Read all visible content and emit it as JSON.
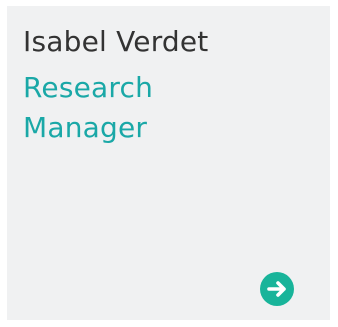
{
  "card": {
    "name": "Isabel Verdet",
    "role": "Research Manager"
  },
  "icons": {
    "action": "arrow-right-icon"
  },
  "colors": {
    "card_background": "#f0f1f2",
    "name_text": "#333333",
    "role_text": "#1aa8a7",
    "arrow_button": "#18b49a"
  }
}
